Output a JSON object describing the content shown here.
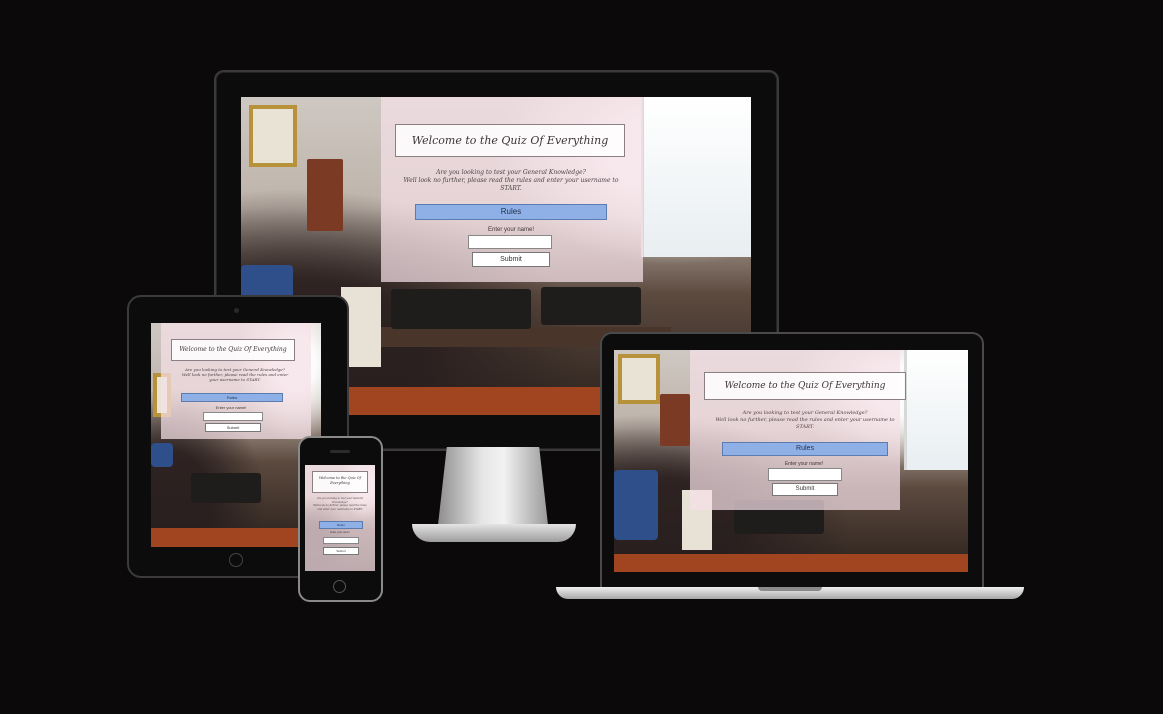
{
  "page": {
    "title": "Welcome to the Quiz Of Everything",
    "intro_line1": "Are you looking to test your General Knowledge?",
    "intro_line2": "Well look no further, please read the rules and enter your username to START.",
    "rules_label": "Rules",
    "name_label": "Enter your name!",
    "name_placeholder": "",
    "submit_label": "Submit"
  },
  "colors": {
    "background": "#0b0909",
    "overlay": "#f5e1e8",
    "rules_button": "#8fb0e6",
    "device_frame": "#111111",
    "silver": "#c9c9c9"
  },
  "devices": [
    "desktop-monitor",
    "tablet",
    "laptop",
    "phone"
  ]
}
